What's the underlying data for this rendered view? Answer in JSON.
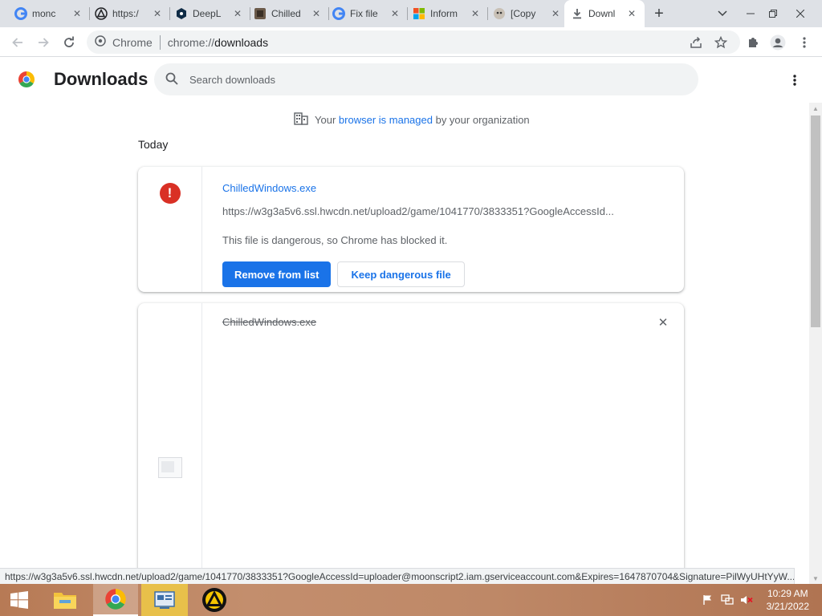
{
  "tabs": [
    {
      "title": "monc",
      "icon": "google-icon"
    },
    {
      "title": "https:/",
      "icon": "alert-triangle-icon"
    },
    {
      "title": "DeepL",
      "icon": "deepl-icon"
    },
    {
      "title": "Chilled",
      "icon": "itch-icon"
    },
    {
      "title": "Fix file",
      "icon": "google-icon"
    },
    {
      "title": "Inform",
      "icon": "microsoft-icon"
    },
    {
      "title": "[Copy",
      "icon": "meme-icon"
    },
    {
      "title": "Downl",
      "icon": "download-icon",
      "active": true
    }
  ],
  "omnibox": {
    "host_label": "Chrome",
    "url_path": "downloads",
    "url_scheme": "chrome://"
  },
  "page": {
    "title": "Downloads",
    "search_placeholder": "Search downloads"
  },
  "managed_notice": {
    "prefix": "Your",
    "link": "browser is managed",
    "suffix": "by your organization"
  },
  "date_label": "Today",
  "downloads": [
    {
      "file_name": "ChilledWindows.exe",
      "url": "https://w3g3a5v6.ssl.hwcdn.net/upload2/game/1041770/3833351?GoogleAccessId...",
      "status": "This file is dangerous, so Chrome has blocked it.",
      "remove_label": "Remove from list",
      "keep_label": "Keep dangerous file"
    },
    {
      "file_name": "ChilledWindows.exe",
      "description": ""
    }
  ],
  "status_bar": "https://w3g3a5v6.ssl.hwcdn.net/upload2/game/1041770/3833351?GoogleAccessId=uploader@moonscript2.iam.gserviceaccount.com&Expires=1647870704&Signature=PilWyUHtYyW...",
  "clock": {
    "time": "10:29 AM",
    "date": "3/21/2022"
  },
  "colors": {
    "accent": "#1a73e8",
    "danger": "#d93025",
    "tabstrip": "#dee1e6"
  }
}
